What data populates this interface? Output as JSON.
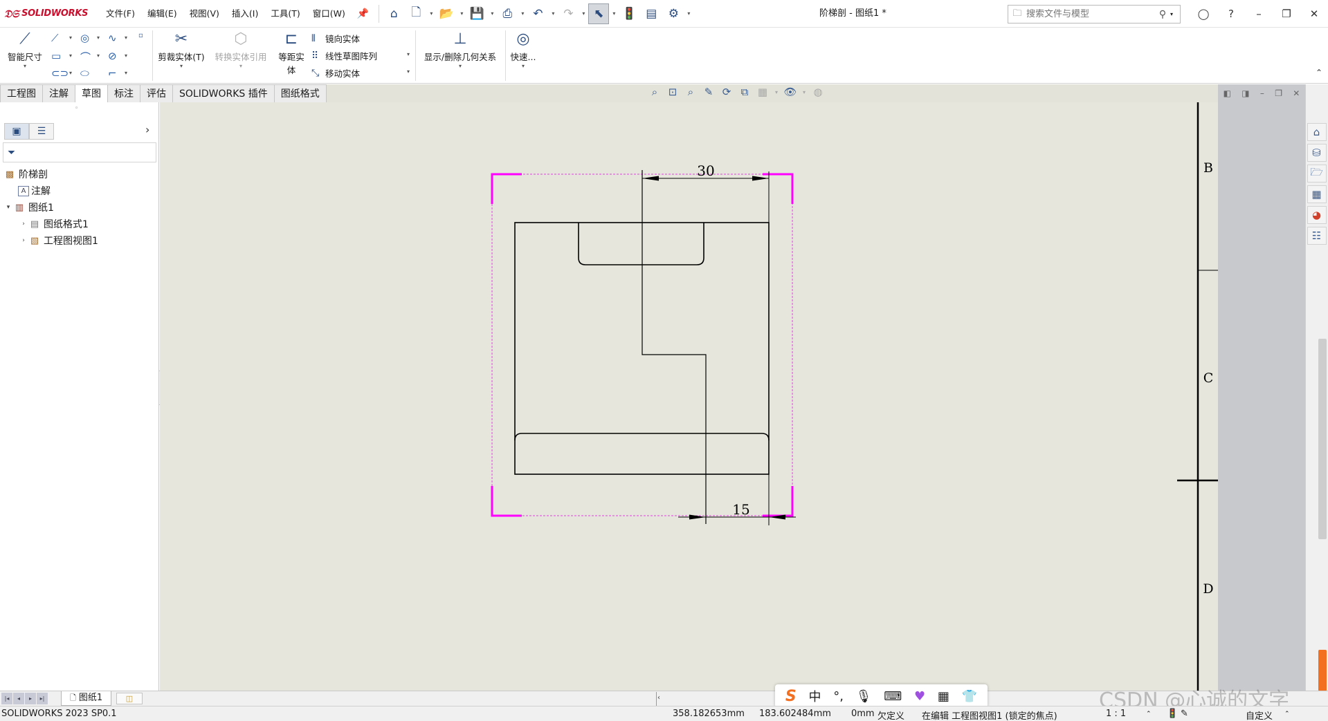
{
  "app": {
    "logo_text": "SOLIDWORKS",
    "doc_title": "阶梯剖 - 图纸1 *"
  },
  "menu": [
    "文件(F)",
    "编辑(E)",
    "视图(V)",
    "插入(I)",
    "工具(T)",
    "窗口(W)"
  ],
  "quick_access_icons": [
    "home-icon",
    "new-document-icon",
    "open-icon",
    "save-icon",
    "print-icon",
    "undo-icon",
    "redo-icon",
    "select-icon",
    "rebuild-icon",
    "file-properties-icon",
    "options-icon"
  ],
  "search": {
    "placeholder": "搜索文件与模型"
  },
  "ribbon": {
    "smart_dimension": "智能尺寸",
    "trim_entities": "剪裁实体(T)",
    "convert_entities": "转换实体引用",
    "offset_entities": "等距实",
    "offset_entities_2": "体",
    "mirror_entities": "镜向实体",
    "linear_pattern": "线性草图阵列",
    "move_entities": "移动实体",
    "display_relations": "显示/删除几何关系",
    "quick_snaps": "快速..."
  },
  "tabs": [
    {
      "label": "工程图",
      "active": false
    },
    {
      "label": "注解",
      "active": false
    },
    {
      "label": "草图",
      "active": true
    },
    {
      "label": "标注",
      "active": false
    },
    {
      "label": "评估",
      "active": false
    },
    {
      "label": "SOLIDWORKS 插件",
      "active": false
    },
    {
      "label": "图纸格式",
      "active": false
    }
  ],
  "feature_tree": [
    {
      "label": "阶梯剖",
      "level": 0,
      "expander": "",
      "icon": "drawing-icon"
    },
    {
      "label": "注解",
      "level": 1,
      "expander": "",
      "icon": "annotations-icon"
    },
    {
      "label": "图纸1",
      "level": 0,
      "expander": "▾",
      "icon": "sheet-icon"
    },
    {
      "label": "图纸格式1",
      "level": 1,
      "expander": "›",
      "icon": "sheet-format-icon"
    },
    {
      "label": "工程图视图1",
      "level": 1,
      "expander": "›",
      "icon": "drawing-view-icon"
    }
  ],
  "drawing": {
    "dim_top": "30",
    "dim_bottom": "15",
    "zone_b": "B",
    "zone_c": "C",
    "zone_d": "D"
  },
  "sheet_tab": {
    "label": "图纸1"
  },
  "ime": {
    "items": [
      "S",
      "中",
      "°,",
      "mic-icon",
      "keyboard-icon",
      "skin-icon",
      "toolbox-icon",
      "clothes-icon"
    ]
  },
  "watermark": "CSDN @心诚的文字",
  "status": {
    "version": "SOLIDWORKS 2023 SP0.1",
    "x_coord": "358.182653mm",
    "y_coord": "183.602484mm",
    "z_coord": "0mm",
    "definition": "欠定义",
    "editing": "在编辑 工程图视图1 (锁定的焦点)",
    "scale": "1 : 1",
    "units": "自定义"
  }
}
